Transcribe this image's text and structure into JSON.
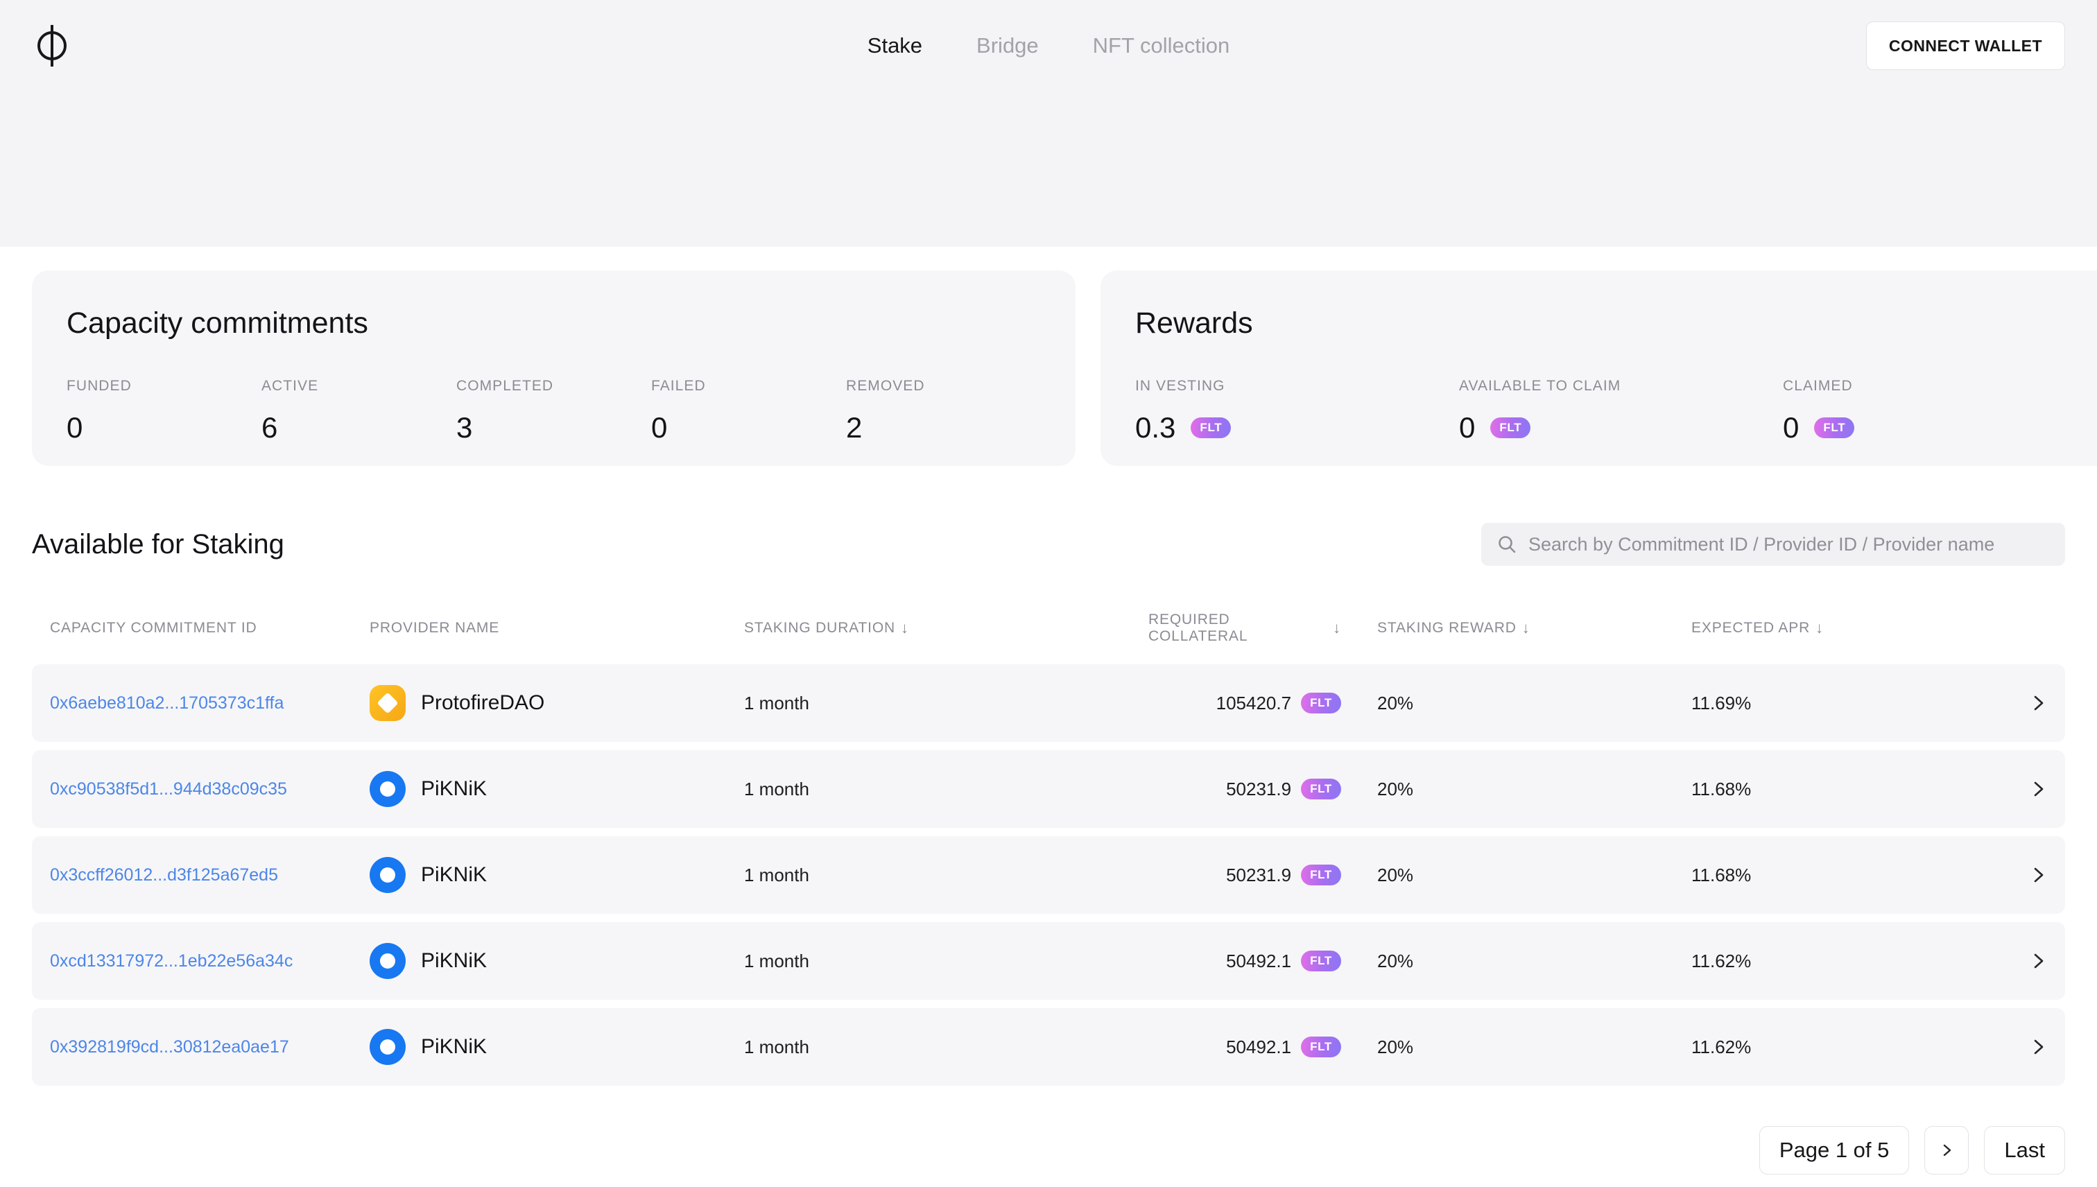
{
  "nav": {
    "items": [
      {
        "label": "Stake"
      },
      {
        "label": "Bridge"
      },
      {
        "label": "NFT collection"
      }
    ],
    "connect_wallet_label": "CONNECT WALLET"
  },
  "icons": {
    "sort_desc": "↓"
  },
  "colors": {
    "link": "#4c86e8",
    "badge_gradient_start": "#e26ee8",
    "badge_gradient_end": "#8a77f4",
    "protofire_yellow": "#f6a714",
    "piknik_blue": "#1778f2"
  },
  "capacity_card": {
    "title": "Capacity commitments",
    "stats": [
      {
        "label": "FUNDED",
        "value": "0"
      },
      {
        "label": "ACTIVE",
        "value": "6"
      },
      {
        "label": "COMPLETED",
        "value": "3"
      },
      {
        "label": "FAILED",
        "value": "0"
      },
      {
        "label": "REMOVED",
        "value": "2"
      }
    ]
  },
  "rewards_card": {
    "title": "Rewards",
    "stats": [
      {
        "label": "IN VESTING",
        "value": "0.3",
        "token": "FLT"
      },
      {
        "label": "AVAILABLE TO CLAIM",
        "value": "0",
        "token": "FLT"
      },
      {
        "label": "CLAIMED",
        "value": "0",
        "token": "FLT"
      }
    ]
  },
  "staking": {
    "title": "Available for Staking",
    "search_placeholder": "Search by Commitment ID / Provider ID / Provider name",
    "columns": [
      {
        "label": "CAPACITY COMMITMENT ID"
      },
      {
        "label": "PROVIDER NAME"
      },
      {
        "label": "STAKING DURATION"
      },
      {
        "label": "REQUIRED COLLATERAL"
      },
      {
        "label": "STAKING REWARD"
      },
      {
        "label": "EXPECTED APR"
      }
    ],
    "rows": [
      {
        "id": "0x6aebe810a2...1705373c1ffa",
        "provider": "ProtofireDAO",
        "duration": "1 month",
        "collateral": "105420.7",
        "token": "FLT",
        "reward": "20%",
        "apr": "11.69%"
      },
      {
        "id": "0xc90538f5d1...944d38c09c35",
        "provider": "PiKNiK",
        "duration": "1 month",
        "collateral": "50231.9",
        "token": "FLT",
        "reward": "20%",
        "apr": "11.68%"
      },
      {
        "id": "0x3ccff26012...d3f125a67ed5",
        "provider": "PiKNiK",
        "duration": "1 month",
        "collateral": "50231.9",
        "token": "FLT",
        "reward": "20%",
        "apr": "11.68%"
      },
      {
        "id": "0xcd13317972...1eb22e56a34c",
        "provider": "PiKNiK",
        "duration": "1 month",
        "collateral": "50492.1",
        "token": "FLT",
        "reward": "20%",
        "apr": "11.62%"
      },
      {
        "id": "0x392819f9cd...30812ea0ae17",
        "provider": "PiKNiK",
        "duration": "1 month",
        "collateral": "50492.1",
        "token": "FLT",
        "reward": "20%",
        "apr": "11.62%"
      }
    ]
  },
  "pagination": {
    "page_label": "Page 1 of 5",
    "last_label": "Last"
  }
}
